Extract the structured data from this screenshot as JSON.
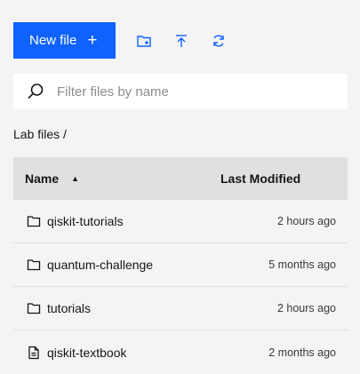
{
  "toolbar": {
    "new_file_label": "New file",
    "new_file_plus": "+",
    "icons": [
      "new-folder-icon",
      "upload-icon",
      "refresh-icon"
    ]
  },
  "search": {
    "placeholder": "Filter files by name",
    "value": ""
  },
  "breadcrumb": {
    "text": "Lab files /"
  },
  "table": {
    "columns": {
      "name": "Name",
      "sort_indicator": "▲",
      "modified": "Last Modified"
    },
    "rows": [
      {
        "type": "folder",
        "name": "qiskit-tutorials",
        "modified": "2 hours ago"
      },
      {
        "type": "folder",
        "name": "quantum-challenge",
        "modified": "5 months ago"
      },
      {
        "type": "folder",
        "name": "tutorials",
        "modified": "2 hours ago"
      },
      {
        "type": "file",
        "name": "qiskit-textbook",
        "modified": "2 months ago"
      }
    ]
  },
  "colors": {
    "accent": "#0f62fe",
    "background": "#f4f4f4",
    "header": "#e0e0e0"
  }
}
